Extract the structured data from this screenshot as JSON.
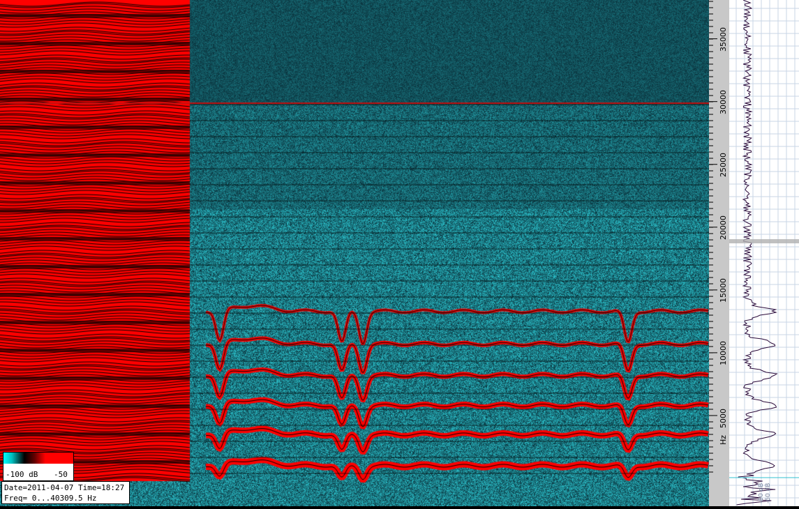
{
  "chart_data": {
    "type": "heatmap",
    "title": "",
    "xlabel": "",
    "ylabel": "Hz",
    "ylim": [
      0,
      40309.5
    ],
    "y_ticks": [
      5000,
      10000,
      15000,
      20000,
      25000,
      30000,
      35000
    ],
    "y_tick_labels": [
      "5000",
      "10000",
      "15000",
      "20000",
      "25000",
      "30000",
      "35000"
    ],
    "colorbar": {
      "min_label": "-100 dB",
      "max_label": "-50",
      "colors": [
        "#00ffff",
        "#000000",
        "#ff0000"
      ]
    },
    "harmonic_bands_hz": [
      1000,
      3500,
      5800,
      8200,
      10700,
      13300
    ],
    "spectrum_side_labels": [
      "-80 dB",
      "-60 dB"
    ]
  },
  "info": {
    "line1": "Date=2011-04-07 Time=18:27",
    "line2": "Freq= 0...40309.5 Hz"
  },
  "colors": {
    "background": "#063c44",
    "noise": "#2fb7c0",
    "signal": "#ff0000",
    "axis_bg": "#c8c8c8"
  }
}
